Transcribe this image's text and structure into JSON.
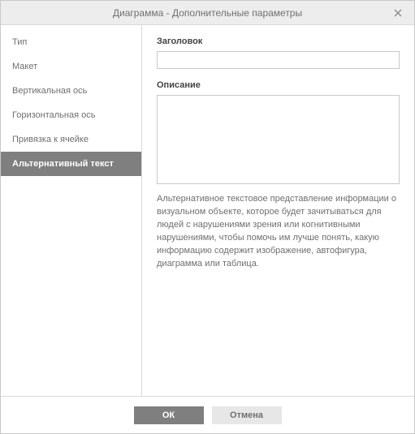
{
  "dialog": {
    "title": "Диаграмма - Дополнительные параметры"
  },
  "sidebar": {
    "items": [
      {
        "label": "Тип",
        "active": false
      },
      {
        "label": "Макет",
        "active": false
      },
      {
        "label": "Вертикальная ось",
        "active": false
      },
      {
        "label": "Горизонтальная ось",
        "active": false
      },
      {
        "label": "Привязка к ячейке",
        "active": false
      },
      {
        "label": "Альтернативный текст",
        "active": true
      }
    ]
  },
  "content": {
    "title_label": "Заголовок",
    "title_value": "",
    "description_label": "Описание",
    "description_value": "",
    "help_text": "Альтернативное текстовое представление информации о визуальном объекте, которое будет зачитываться для людей с нарушениями зрения или когнитивными нарушениями, чтобы помочь им лучше понять, какую информацию содержит изображение, автофигура, диаграмма или таблица."
  },
  "footer": {
    "ok_label": "ОК",
    "cancel_label": "Отмена"
  }
}
